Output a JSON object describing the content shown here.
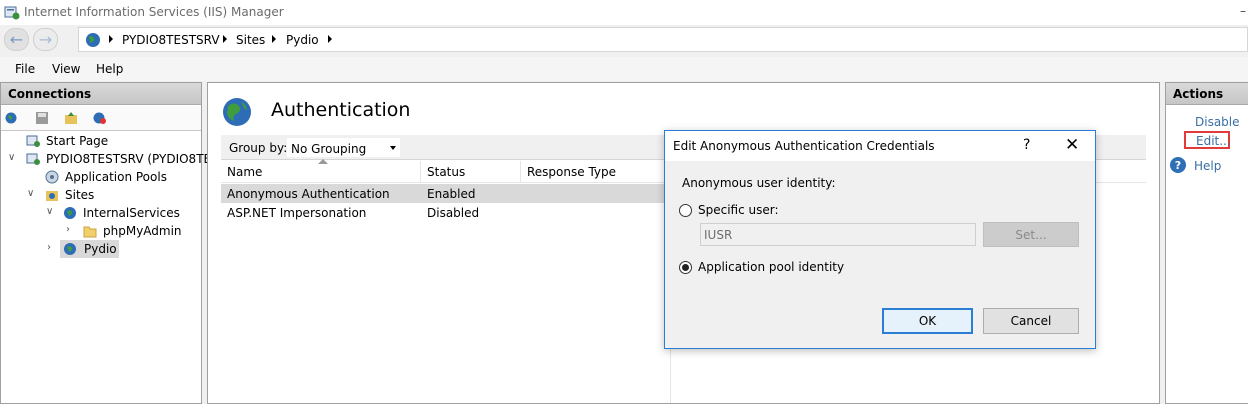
{
  "window": {
    "title": "Internet Information Services (IIS) Manager",
    "minimize_glyph": "–"
  },
  "address": {
    "crumbs": [
      "PYDIO8TESTSRV",
      "Sites",
      "Pydio"
    ],
    "back_icon": "←",
    "forward_icon": "→"
  },
  "menu": {
    "items": [
      "File",
      "View",
      "Help"
    ]
  },
  "connections": {
    "header": "Connections",
    "tree": {
      "start_page": "Start Page",
      "server": "PYDIO8TESTSRV (PYDIO8TEST",
      "app_pools": "Application Pools",
      "sites": "Sites",
      "internal_services": "InternalServices",
      "phpmyadmin": "phpMyAdmin",
      "pydio": "Pydio"
    }
  },
  "main": {
    "heading": "Authentication",
    "group_by_label": "Group by:",
    "group_by_value": "No Grouping",
    "columns": [
      "Name",
      "Status",
      "Response Type"
    ],
    "rows": [
      {
        "name": "Anonymous Authentication",
        "status": "Enabled",
        "response_type": ""
      },
      {
        "name": "ASP.NET Impersonation",
        "status": "Disabled",
        "response_type": ""
      }
    ]
  },
  "actions": {
    "header": "Actions",
    "disable": "Disable",
    "edit": "Edit...",
    "help": "Help",
    "help_icon": "?"
  },
  "dialog": {
    "title": "Edit Anonymous Authentication Credentials",
    "help_glyph": "?",
    "close_glyph": "✕",
    "section_label": "Anonymous user identity:",
    "specific_user_label": "Specific user:",
    "user_value": "IUSR",
    "set_button": "Set...",
    "app_pool_label": "Application pool identity",
    "selected_option": "application_pool_identity",
    "ok_button": "OK",
    "cancel_button": "Cancel"
  },
  "colors": {
    "accent": "#2a7fd4",
    "link": "#3a6ea5",
    "highlight": "#e23b3b",
    "selection": "#d9d9d9"
  }
}
